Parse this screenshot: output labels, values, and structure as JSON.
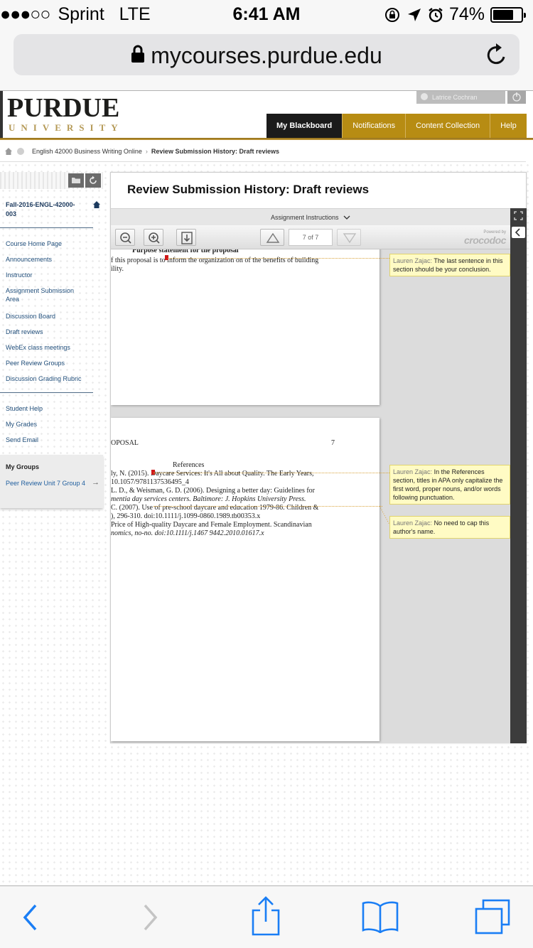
{
  "status_bar": {
    "signal": "●●●○○",
    "carrier": "Sprint",
    "network": "LTE",
    "time": "6:41 AM",
    "battery": "74%",
    "battery_level": 0.74
  },
  "browser": {
    "url": "mycourses.purdue.edu"
  },
  "header": {
    "logo_main": "PURDUE",
    "logo_sub": "UNIVERSITY",
    "user_name": "Latrice Cochran",
    "tabs": [
      {
        "label": "My Blackboard"
      },
      {
        "label": "Notifications"
      },
      {
        "label": "Content Collection"
      },
      {
        "label": "Help"
      }
    ]
  },
  "breadcrumb": {
    "course": "English 42000 Business Writing Online",
    "separator": "›",
    "current": "Review Submission History: Draft reviews"
  },
  "sidebar": {
    "course_id": "Fall-2016-ENGL-42000-003",
    "links": [
      {
        "label": "Course Home Page"
      },
      {
        "label": "Announcements"
      },
      {
        "label": "Instructor"
      },
      {
        "label": "Assignment Submission Area"
      },
      {
        "label": "Discussion Board"
      },
      {
        "label": "Draft reviews"
      },
      {
        "label": "WebEx class meetings"
      },
      {
        "label": "Peer Review Groups"
      },
      {
        "label": "Discussion Grading Rubric"
      }
    ],
    "links2": [
      {
        "label": "Student Help"
      },
      {
        "label": "My Grades"
      },
      {
        "label": "Send Email"
      }
    ],
    "groups_title": "My Groups",
    "group_link": "Peer Review Unit 7 Group 4",
    "group_arrow": "→"
  },
  "main": {
    "title": "Review Submission History: Draft reviews",
    "instructions_label": "Assignment Instructions",
    "page_indicator": "7 of 7",
    "powered_by": "Powered by",
    "brand": "crocodoc"
  },
  "document": {
    "page1": {
      "heading": "Purpose statement for the proposal",
      "line1": "f this proposal is to inform the organization on of the benefits of building",
      "line2": "ility."
    },
    "page2": {
      "running_head": "OPOSAL",
      "page_number": "7",
      "references_heading": "References",
      "lines": [
        "ly, N. (2015). Daycare Services: It's All about Quality. The Early Years,",
        "10.1057/9781137536495_4",
        "L. D., & Weisman, G. D. (2006). Designing a better day: Guidelines for",
        "mentia day services centers. Baltimore: J. Hopkins University Press.",
        "C. (2007). Use of pre-school daycare and education 1979-86. Children &",
        "), 296-310. doi:10.1111/j.1099-0860.1989.tb00353.x",
        " Price of High-quality Daycare and Female Employment.     Scandinavian",
        "nomics, no-no. doi:10.1111/j.1467     9442.2010.01617.x"
      ]
    }
  },
  "annotations": [
    {
      "author": "Lauren Zajac:",
      "text": "The last sentence in this section should be your conclusion."
    },
    {
      "author": "Lauren Zajac:",
      "text": "In the References section, titles in APA only capitalize the first word, proper nouns, and/or words following punctuation."
    },
    {
      "author": "Lauren Zajac:",
      "text": "No need to cap this author's name."
    }
  ],
  "colors": {
    "gold": "#b78c13",
    "ios_blue": "#1a7ef5",
    "note_bg": "#fffbc4"
  }
}
